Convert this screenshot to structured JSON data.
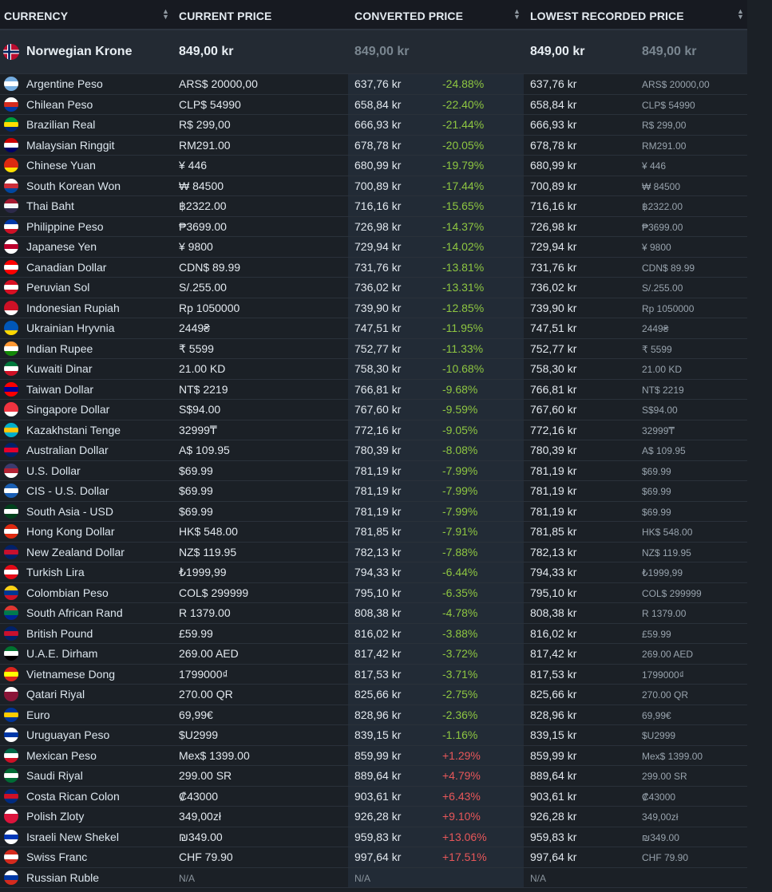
{
  "headers": {
    "currency": "CURRENCY",
    "current_price": "CURRENT PRICE",
    "converted_price": "CONVERTED PRICE",
    "lowest_recorded_price": "LOWEST RECORDED PRICE"
  },
  "highlight": {
    "name": "Norwegian Krone",
    "price": "849,00 kr",
    "converted": "849,00 kr",
    "lowest": "849,00 kr",
    "lowest_src": "849,00 kr",
    "flag_icon": "norway-flag-icon"
  },
  "colors": {
    "negative": "#8ec641",
    "positive": "#e8575a",
    "background": "#1b2026"
  },
  "rows": [
    {
      "name": "Argentine Peso",
      "price": "ARS$ 20000,00",
      "conv": "637,76 kr",
      "diff": "-24.88%",
      "low": "637,76 kr",
      "lowsrc": "ARS$ 20000,00",
      "flag": [
        "#74acdf",
        "#ffffff",
        "#74acdf"
      ]
    },
    {
      "name": "Chilean Peso",
      "price": "CLP$ 54990",
      "conv": "658,84 kr",
      "diff": "-22.40%",
      "low": "658,84 kr",
      "lowsrc": "CLP$ 54990",
      "flag": [
        "#ffffff",
        "#d52b1e",
        "#0039a6"
      ]
    },
    {
      "name": "Brazilian Real",
      "price": "R$ 299,00",
      "conv": "666,93 kr",
      "diff": "-21.44%",
      "low": "666,93 kr",
      "lowsrc": "R$ 299,00",
      "flag": [
        "#009c3b",
        "#ffdf00",
        "#002776"
      ]
    },
    {
      "name": "Malaysian Ringgit",
      "price": "RM291.00",
      "conv": "678,78 kr",
      "diff": "-20.05%",
      "low": "678,78 kr",
      "lowsrc": "RM291.00",
      "flag": [
        "#cc0001",
        "#ffffff",
        "#010066"
      ]
    },
    {
      "name": "Chinese Yuan",
      "price": "¥ 446",
      "conv": "680,99 kr",
      "diff": "-19.79%",
      "low": "680,99 kr",
      "lowsrc": "¥ 446",
      "flag": [
        "#de2910",
        "#de2910",
        "#ffde00"
      ]
    },
    {
      "name": "South Korean Won",
      "price": "₩ 84500",
      "conv": "700,89 kr",
      "diff": "-17.44%",
      "low": "700,89 kr",
      "lowsrc": "₩ 84500",
      "flag": [
        "#ffffff",
        "#cd2e3a",
        "#0047a0"
      ]
    },
    {
      "name": "Thai Baht",
      "price": "฿2322.00",
      "conv": "716,16 kr",
      "diff": "-15.65%",
      "low": "716,16 kr",
      "lowsrc": "฿2322.00",
      "flag": [
        "#a51931",
        "#f4f5f8",
        "#2d2a4a"
      ]
    },
    {
      "name": "Philippine Peso",
      "price": "₱3699.00",
      "conv": "726,98 kr",
      "diff": "-14.37%",
      "low": "726,98 kr",
      "lowsrc": "₱3699.00",
      "flag": [
        "#0038a8",
        "#ffffff",
        "#ce1126"
      ]
    },
    {
      "name": "Japanese Yen",
      "price": "¥ 9800",
      "conv": "729,94 kr",
      "diff": "-14.02%",
      "low": "729,94 kr",
      "lowsrc": "¥ 9800",
      "flag": [
        "#ffffff",
        "#bc002d",
        "#ffffff"
      ]
    },
    {
      "name": "Canadian Dollar",
      "price": "CDN$ 89.99",
      "conv": "731,76 kr",
      "diff": "-13.81%",
      "low": "731,76 kr",
      "lowsrc": "CDN$ 89.99",
      "flag": [
        "#ff0000",
        "#ffffff",
        "#ff0000"
      ]
    },
    {
      "name": "Peruvian Sol",
      "price": "S/.255.00",
      "conv": "736,02 kr",
      "diff": "-13.31%",
      "low": "736,02 kr",
      "lowsrc": "S/.255.00",
      "flag": [
        "#d91023",
        "#ffffff",
        "#d91023"
      ]
    },
    {
      "name": "Indonesian Rupiah",
      "price": "Rp 1050000",
      "conv": "739,90 kr",
      "diff": "-12.85%",
      "low": "739,90 kr",
      "lowsrc": "Rp 1050000",
      "flag": [
        "#ce1126",
        "#ce1126",
        "#ffffff"
      ]
    },
    {
      "name": "Ukrainian Hryvnia",
      "price": "2449₴",
      "conv": "747,51 kr",
      "diff": "-11.95%",
      "low": "747,51 kr",
      "lowsrc": "2449₴",
      "flag": [
        "#0057b7",
        "#0057b7",
        "#ffd700"
      ]
    },
    {
      "name": "Indian Rupee",
      "price": "₹ 5599",
      "conv": "752,77 kr",
      "diff": "-11.33%",
      "low": "752,77 kr",
      "lowsrc": "₹ 5599",
      "flag": [
        "#ff9933",
        "#ffffff",
        "#138808"
      ]
    },
    {
      "name": "Kuwaiti Dinar",
      "price": "21.00 KD",
      "conv": "758,30 kr",
      "diff": "-10.68%",
      "low": "758,30 kr",
      "lowsrc": "21.00 KD",
      "flag": [
        "#007a3d",
        "#ffffff",
        "#ce1126"
      ]
    },
    {
      "name": "Taiwan Dollar",
      "price": "NT$ 2219",
      "conv": "766,81 kr",
      "diff": "-9.68%",
      "low": "766,81 kr",
      "lowsrc": "NT$ 2219",
      "flag": [
        "#fe0000",
        "#000095",
        "#fe0000"
      ]
    },
    {
      "name": "Singapore Dollar",
      "price": "S$94.00",
      "conv": "767,60 kr",
      "diff": "-9.59%",
      "low": "767,60 kr",
      "lowsrc": "S$94.00",
      "flag": [
        "#ef3340",
        "#ef3340",
        "#ffffff"
      ]
    },
    {
      "name": "Kazakhstani Tenge",
      "price": "32999₸",
      "conv": "772,16 kr",
      "diff": "-9.05%",
      "low": "772,16 kr",
      "lowsrc": "32999₸",
      "flag": [
        "#00afca",
        "#fec50c",
        "#00afca"
      ]
    },
    {
      "name": "Australian Dollar",
      "price": "A$ 109.95",
      "conv": "780,39 kr",
      "diff": "-8.08%",
      "low": "780,39 kr",
      "lowsrc": "A$ 109.95",
      "flag": [
        "#012169",
        "#e4002b",
        "#012169"
      ]
    },
    {
      "name": "U.S. Dollar",
      "price": "$69.99",
      "conv": "781,19 kr",
      "diff": "-7.99%",
      "low": "781,19 kr",
      "lowsrc": "$69.99",
      "flag": [
        "#3c3b6e",
        "#b22234",
        "#ffffff"
      ]
    },
    {
      "name": "CIS - U.S. Dollar",
      "price": "$69.99",
      "conv": "781,19 kr",
      "diff": "-7.99%",
      "low": "781,19 kr",
      "lowsrc": "$69.99",
      "flag": [
        "#1a5fb4",
        "#ffffff",
        "#1a5fb4"
      ]
    },
    {
      "name": "South Asia - USD",
      "price": "$69.99",
      "conv": "781,19 kr",
      "diff": "-7.99%",
      "low": "781,19 kr",
      "lowsrc": "$69.99",
      "flag": [
        "#01411c",
        "#ffffff",
        "#01411c"
      ]
    },
    {
      "name": "Hong Kong Dollar",
      "price": "HK$ 548.00",
      "conv": "781,85 kr",
      "diff": "-7.91%",
      "low": "781,85 kr",
      "lowsrc": "HK$ 548.00",
      "flag": [
        "#de2910",
        "#ffffff",
        "#de2910"
      ]
    },
    {
      "name": "New Zealand Dollar",
      "price": "NZ$ 119.95",
      "conv": "782,13 kr",
      "diff": "-7.88%",
      "low": "782,13 kr",
      "lowsrc": "NZ$ 119.95",
      "flag": [
        "#012169",
        "#c8102e",
        "#012169"
      ]
    },
    {
      "name": "Turkish Lira",
      "price": "₺1999,99",
      "conv": "794,33 kr",
      "diff": "-6.44%",
      "low": "794,33 kr",
      "lowsrc": "₺1999,99",
      "flag": [
        "#e30a17",
        "#ffffff",
        "#e30a17"
      ]
    },
    {
      "name": "Colombian Peso",
      "price": "COL$ 299999",
      "conv": "795,10 kr",
      "diff": "-6.35%",
      "low": "795,10 kr",
      "lowsrc": "COL$ 299999",
      "flag": [
        "#fcd116",
        "#003893",
        "#ce1126"
      ]
    },
    {
      "name": "South African Rand",
      "price": "R 1379.00",
      "conv": "808,38 kr",
      "diff": "-4.78%",
      "low": "808,38 kr",
      "lowsrc": "R 1379.00",
      "flag": [
        "#de3831",
        "#007a4d",
        "#002395"
      ]
    },
    {
      "name": "British Pound",
      "price": "£59.99",
      "conv": "816,02 kr",
      "diff": "-3.88%",
      "low": "816,02 kr",
      "lowsrc": "£59.99",
      "flag": [
        "#012169",
        "#c8102e",
        "#012169"
      ]
    },
    {
      "name": "U.A.E. Dirham",
      "price": "269.00 AED",
      "conv": "817,42 kr",
      "diff": "-3.72%",
      "low": "817,42 kr",
      "lowsrc": "269.00 AED",
      "flag": [
        "#00732f",
        "#ffffff",
        "#000000"
      ]
    },
    {
      "name": "Vietnamese Dong",
      "price": "1799000₫",
      "conv": "817,53 kr",
      "diff": "-3.71%",
      "low": "817,53 kr",
      "lowsrc": "1799000₫",
      "flag": [
        "#da251d",
        "#ffff00",
        "#da251d"
      ]
    },
    {
      "name": "Qatari Riyal",
      "price": "270.00 QR",
      "conv": "825,66 kr",
      "diff": "-2.75%",
      "low": "825,66 kr",
      "lowsrc": "270.00 QR",
      "flag": [
        "#ffffff",
        "#8a1538",
        "#8a1538"
      ]
    },
    {
      "name": "Euro",
      "price": "69,99€",
      "conv": "828,96 kr",
      "diff": "-2.36%",
      "low": "828,96 kr",
      "lowsrc": "69,99€",
      "flag": [
        "#003399",
        "#ffcc00",
        "#003399"
      ]
    },
    {
      "name": "Uruguayan Peso",
      "price": "$U2999",
      "conv": "839,15 kr",
      "diff": "-1.16%",
      "low": "839,15 kr",
      "lowsrc": "$U2999",
      "flag": [
        "#ffffff",
        "#0038a8",
        "#ffffff"
      ]
    },
    {
      "name": "Mexican Peso",
      "price": "Mex$ 1399.00",
      "conv": "859,99 kr",
      "diff": "+1.29%",
      "low": "859,99 kr",
      "lowsrc": "Mex$ 1399.00",
      "flag": [
        "#006847",
        "#ffffff",
        "#ce1126"
      ]
    },
    {
      "name": "Saudi Riyal",
      "price": "299.00 SR",
      "conv": "889,64 kr",
      "diff": "+4.79%",
      "low": "889,64 kr",
      "lowsrc": "299.00 SR",
      "flag": [
        "#006c35",
        "#ffffff",
        "#006c35"
      ]
    },
    {
      "name": "Costa Rican Colon",
      "price": "₡43000",
      "conv": "903,61 kr",
      "diff": "+6.43%",
      "low": "903,61 kr",
      "lowsrc": "₡43000",
      "flag": [
        "#002b7f",
        "#ce1126",
        "#002b7f"
      ]
    },
    {
      "name": "Polish Zloty",
      "price": "349,00zł",
      "conv": "926,28 kr",
      "diff": "+9.10%",
      "low": "926,28 kr",
      "lowsrc": "349,00zł",
      "flag": [
        "#ffffff",
        "#dc143c",
        "#dc143c"
      ]
    },
    {
      "name": "Israeli New Shekel",
      "price": "₪349.00",
      "conv": "959,83 kr",
      "diff": "+13.06%",
      "low": "959,83 kr",
      "lowsrc": "₪349.00",
      "flag": [
        "#ffffff",
        "#0038b8",
        "#ffffff"
      ]
    },
    {
      "name": "Swiss Franc",
      "price": "CHF 79.90",
      "conv": "997,64 kr",
      "diff": "+17.51%",
      "low": "997,64 kr",
      "lowsrc": "CHF 79.90",
      "flag": [
        "#d52b1e",
        "#ffffff",
        "#d52b1e"
      ]
    },
    {
      "name": "Russian Ruble",
      "price": "N/A",
      "conv": "N/A",
      "diff": "",
      "low": "N/A",
      "lowsrc": "",
      "flag": [
        "#ffffff",
        "#0039a6",
        "#d52b1e"
      ]
    }
  ]
}
